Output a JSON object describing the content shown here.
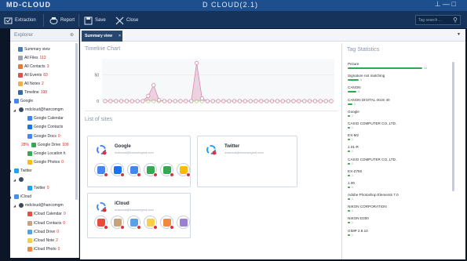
{
  "titlebar": {
    "app_name": "MD-CLOUD",
    "center_text": "D CLOUD(2.1)",
    "controls": "⊥ — □"
  },
  "toolbar": {
    "extraction_label": "Extraction",
    "report_label": "Report",
    "save_label": "Save",
    "close_label": "Close",
    "search_placeholder": "Tag search ..."
  },
  "explorer": {
    "title": "Explorer",
    "items": [
      {
        "label": "Summary view",
        "count": "",
        "pct": "",
        "arrow": "",
        "icon": "summary",
        "color": "#4a78b8"
      },
      {
        "label": "All Files",
        "count": "113",
        "pct": "",
        "arrow": "",
        "icon": "files",
        "color": "#9aa3b0"
      },
      {
        "label": "All Contacts",
        "count": "3",
        "pct": "",
        "arrow": "",
        "icon": "contacts",
        "color": "#e07b39"
      },
      {
        "label": "All Events",
        "count": "83",
        "pct": "",
        "arrow": "",
        "icon": "events",
        "color": "#d9534f"
      },
      {
        "label": "All Notes",
        "count": "2",
        "pct": "",
        "arrow": "",
        "icon": "notes",
        "color": "#f0ad4e"
      },
      {
        "label": "Timeline",
        "count": "198",
        "pct": "",
        "arrow": "",
        "icon": "timeline",
        "color": "#2e6da4"
      },
      {
        "label": "Google",
        "count": "",
        "pct": "",
        "arrow": "◢",
        "icon": "google",
        "color": "#4285f4"
      },
      {
        "label": "mdcloud@hancomgm",
        "count": "",
        "pct": "",
        "arrow": "◢",
        "icon": "user",
        "color": "#3a4a5e"
      },
      {
        "label": "Google Calendar",
        "count": "",
        "pct": "",
        "arrow": "",
        "icon": "gcal",
        "color": "#4285f4"
      },
      {
        "label": "Google Contacts",
        "count": "",
        "pct": "",
        "arrow": "",
        "icon": "gcontacts",
        "color": "#1a73e8"
      },
      {
        "label": "Google Docs",
        "count": "0",
        "pct": "",
        "arrow": "",
        "icon": "gdocs",
        "color": "#4285f4"
      },
      {
        "label": "Google Drive",
        "count": "109",
        "pct": "28%",
        "arrow": "",
        "icon": "gdrive",
        "color": "#34a853"
      },
      {
        "label": "Google Location h",
        "count": "",
        "pct": "",
        "arrow": "",
        "icon": "gloc",
        "color": "#34a853"
      },
      {
        "label": "Google Photos",
        "count": "0",
        "pct": "",
        "arrow": "",
        "icon": "gphotos",
        "color": "#fbbc05"
      },
      {
        "label": "Twitter",
        "count": "",
        "pct": "",
        "arrow": "◢",
        "icon": "twitter",
        "color": "#1da1f2"
      },
      {
        "label": "",
        "count": "",
        "pct": "",
        "arrow": "◢",
        "icon": "user",
        "color": "#3a4a5e"
      },
      {
        "label": "Twitter",
        "count": "0",
        "pct": "",
        "arrow": "",
        "icon": "twitter",
        "color": "#1da1f2"
      },
      {
        "label": "iCloud",
        "count": "",
        "pct": "",
        "arrow": "◢",
        "icon": "icloud",
        "color": "#4a90e2"
      },
      {
        "label": "mdcloud@hancomgm",
        "count": "",
        "pct": "",
        "arrow": "◢",
        "icon": "user",
        "color": "#3a4a5e"
      },
      {
        "label": "iCloud Calendar",
        "count": "0",
        "pct": "",
        "arrow": "",
        "icon": "ical",
        "color": "#e94b3c"
      },
      {
        "label": "iCloud Contacts",
        "count": "0",
        "pct": "",
        "arrow": "",
        "icon": "icontacts",
        "color": "#c8a27a"
      },
      {
        "label": "iCloud Drive",
        "count": "0",
        "pct": "",
        "arrow": "",
        "icon": "idrive",
        "color": "#5aa0e6"
      },
      {
        "label": "iCloud Note",
        "count": "2",
        "pct": "",
        "arrow": "",
        "icon": "inotes",
        "color": "#f5d04a"
      },
      {
        "label": "iCloud Photo",
        "count": "0",
        "pct": "",
        "arrow": "",
        "icon": "iphotos",
        "color": "#f0883e"
      }
    ]
  },
  "tabs": [
    {
      "label": "Summary view",
      "close": "×"
    }
  ],
  "sections": {
    "timeline": "Timeline Chart",
    "sites": "List of sites",
    "tags": "Tag Statistics"
  },
  "timeline_chart": {
    "series": [
      {
        "color": "#b0d488",
        "values": [
          0,
          0,
          0,
          0,
          0,
          0,
          0,
          0,
          0,
          0,
          0,
          0,
          0,
          0,
          0,
          0,
          0,
          0,
          0,
          0,
          0,
          0,
          0,
          0,
          0,
          0,
          0,
          0,
          0,
          0,
          0,
          0,
          0,
          0,
          0,
          0,
          0,
          0,
          0,
          0,
          0,
          0,
          0
        ]
      },
      {
        "color": "#d78ab0",
        "values": [
          0,
          0,
          0,
          0,
          0,
          0,
          0,
          0,
          10,
          30,
          2,
          0,
          0,
          0,
          0,
          0,
          0,
          72,
          5,
          0,
          0,
          0,
          0,
          0,
          0,
          0,
          0,
          0,
          0,
          0,
          0,
          0,
          0,
          0,
          0,
          0,
          0,
          0,
          0,
          0,
          0,
          0,
          0
        ]
      }
    ],
    "y_ticks": [
      "0",
      "50"
    ],
    "ylim": [
      0,
      80
    ]
  },
  "sites": [
    {
      "name": "Google",
      "account": "mdcloud@hancomgmd.com",
      "apps": [
        "gcal",
        "gcontacts",
        "gdocs",
        "gdrive",
        "gmaps",
        "gphotos"
      ]
    },
    {
      "name": "Twitter",
      "account": "mdcloud@hancomgmd.com",
      "apps": []
    },
    {
      "name": "iCloud",
      "account": "mdcloud@hancomgmd.com",
      "apps": [
        "ical",
        "icontacts",
        "idrive",
        "inotes",
        "iphotos",
        "imail"
      ]
    }
  ],
  "tag_stats": [
    {
      "name": "Picture",
      "count": "34"
    },
    {
      "name": "Signature not matching",
      "count": "5"
    },
    {
      "name": "CANON",
      "count": "4"
    },
    {
      "name": "CANON DIGITAL IXUS 40",
      "count": "2"
    },
    {
      "name": "Google",
      "count": "1"
    },
    {
      "name": "CASIO COMPUTER CO.,LTD.",
      "count": "1"
    },
    {
      "name": "EX-M2",
      "count": "1"
    },
    {
      "name": "1.01-R",
      "count": "1"
    },
    {
      "name": "CASIO COMPUTER CO.,LTD.",
      "count": "1"
    },
    {
      "name": "EX-Z750",
      "count": "1"
    },
    {
      "name": "1.00",
      "count": "1"
    },
    {
      "name": "Adobe Photoshop Elements 7.0",
      "count": "1"
    },
    {
      "name": "NIKON CORPORATION",
      "count": "1"
    },
    {
      "name": "NIKON D300",
      "count": "1"
    },
    {
      "name": "GIMP 2.8.10",
      "count": "1"
    }
  ],
  "colors": {
    "accent": "#28476f",
    "bar": "#2ea84a",
    "count_red": "#d12a2a",
    "toolbar": "#16335c"
  }
}
